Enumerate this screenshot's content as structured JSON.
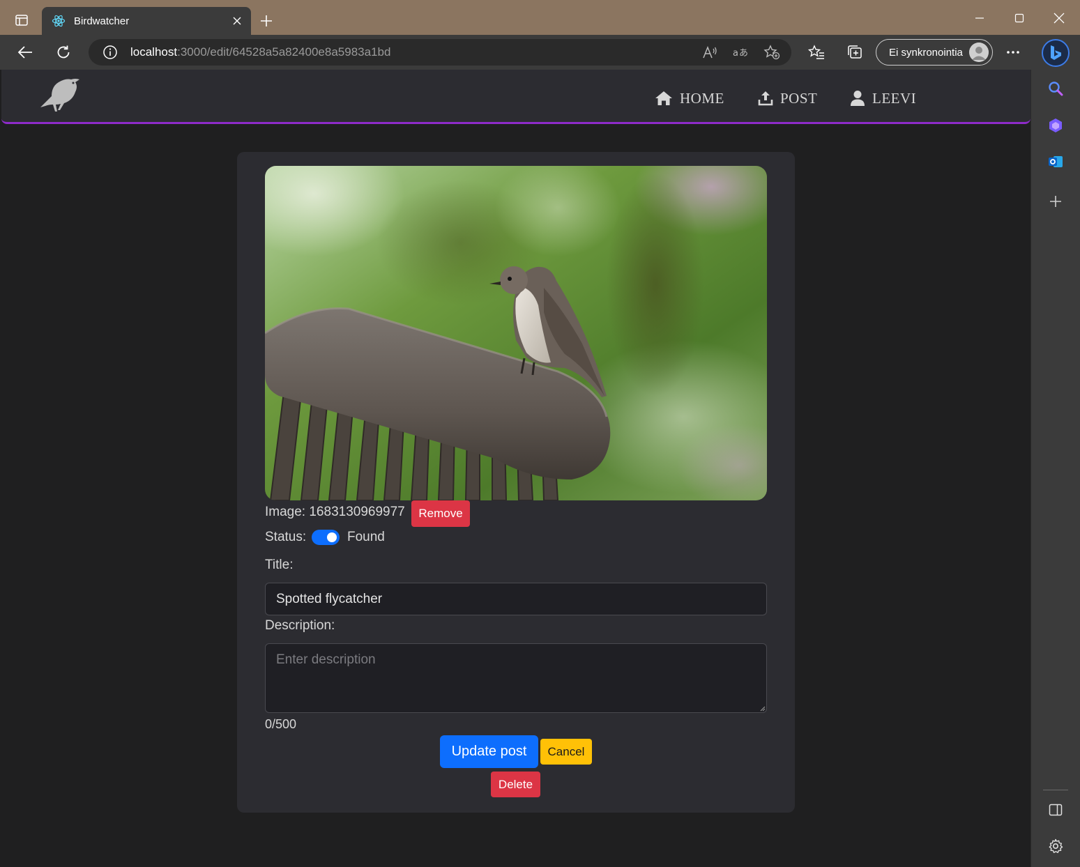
{
  "browser": {
    "tab_title": "Birdwatcher",
    "url_host": "localhost",
    "url_rest": ":3000/edit/64528a5a82400e8a5983a1bd",
    "sync_label": "Ei synkronointia"
  },
  "nav": {
    "items": [
      {
        "label": "HOME",
        "icon": "home-icon"
      },
      {
        "label": "POST",
        "icon": "upload-icon"
      },
      {
        "label": "LEEVI",
        "icon": "user-icon"
      }
    ]
  },
  "form": {
    "image_label": "Image: 1683130969977",
    "remove_label": "Remove",
    "status_label": "Status:",
    "status_value": "Found",
    "status_on": true,
    "title_label": "Title:",
    "title_value": "Spotted flycatcher",
    "description_label": "Description:",
    "description_placeholder": "Enter description",
    "description_value": "",
    "char_count": "0/500",
    "update_label": "Update post",
    "cancel_label": "Cancel",
    "delete_label": "Delete"
  },
  "colors": {
    "accent_purple": "#8e2bc9",
    "primary_blue": "#0d6efd",
    "danger_red": "#dc3545",
    "warning_yellow": "#ffc107",
    "titlebar": "#8b7560"
  }
}
